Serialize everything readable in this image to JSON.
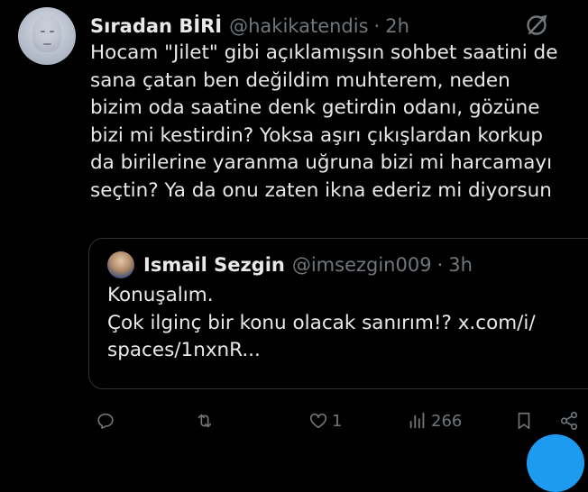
{
  "tweet": {
    "author_name": "Sıradan BİRİ",
    "handle": "@hakikatendis",
    "separator": "·",
    "time": "2h",
    "text": "Hocam \"Jilet\" gibi açıklamışsın sohbet saatini de\nsana çatan ben değildim muhterem, neden\nbizim oda saatine denk getirdin odanı, gözüne\nbizi mi kestirdin? Yoksa aşırı çıkışlardan korkup\nda birilerine yaranma uğruna bizi mi harcamayı\nseçtin? Ya da onu zaten ikna ederiz mi diyorsun"
  },
  "quoted_tweet": {
    "author_name": "Ismail Sezgin",
    "handle": "@imsezgin009",
    "separator": "·",
    "time": "3h",
    "text": "Konuşalım.\nÇok ilginç bir konu olacak sanırım!? x.com/i/\nspaces/1nxnR..."
  },
  "actions": {
    "reply_icon": "reply-icon",
    "retweet_icon": "retweet-icon",
    "like_icon": "heart-icon",
    "like_count": "1",
    "views_icon": "views-icon",
    "views_count": "266",
    "bookmark_icon": "bookmark-icon",
    "share_icon": "share-icon"
  },
  "colors": {
    "background": "#000000",
    "text": "#e7e9ea",
    "secondary": "#71767b",
    "accent": "#1d9bf0",
    "border": "#2f3336"
  }
}
